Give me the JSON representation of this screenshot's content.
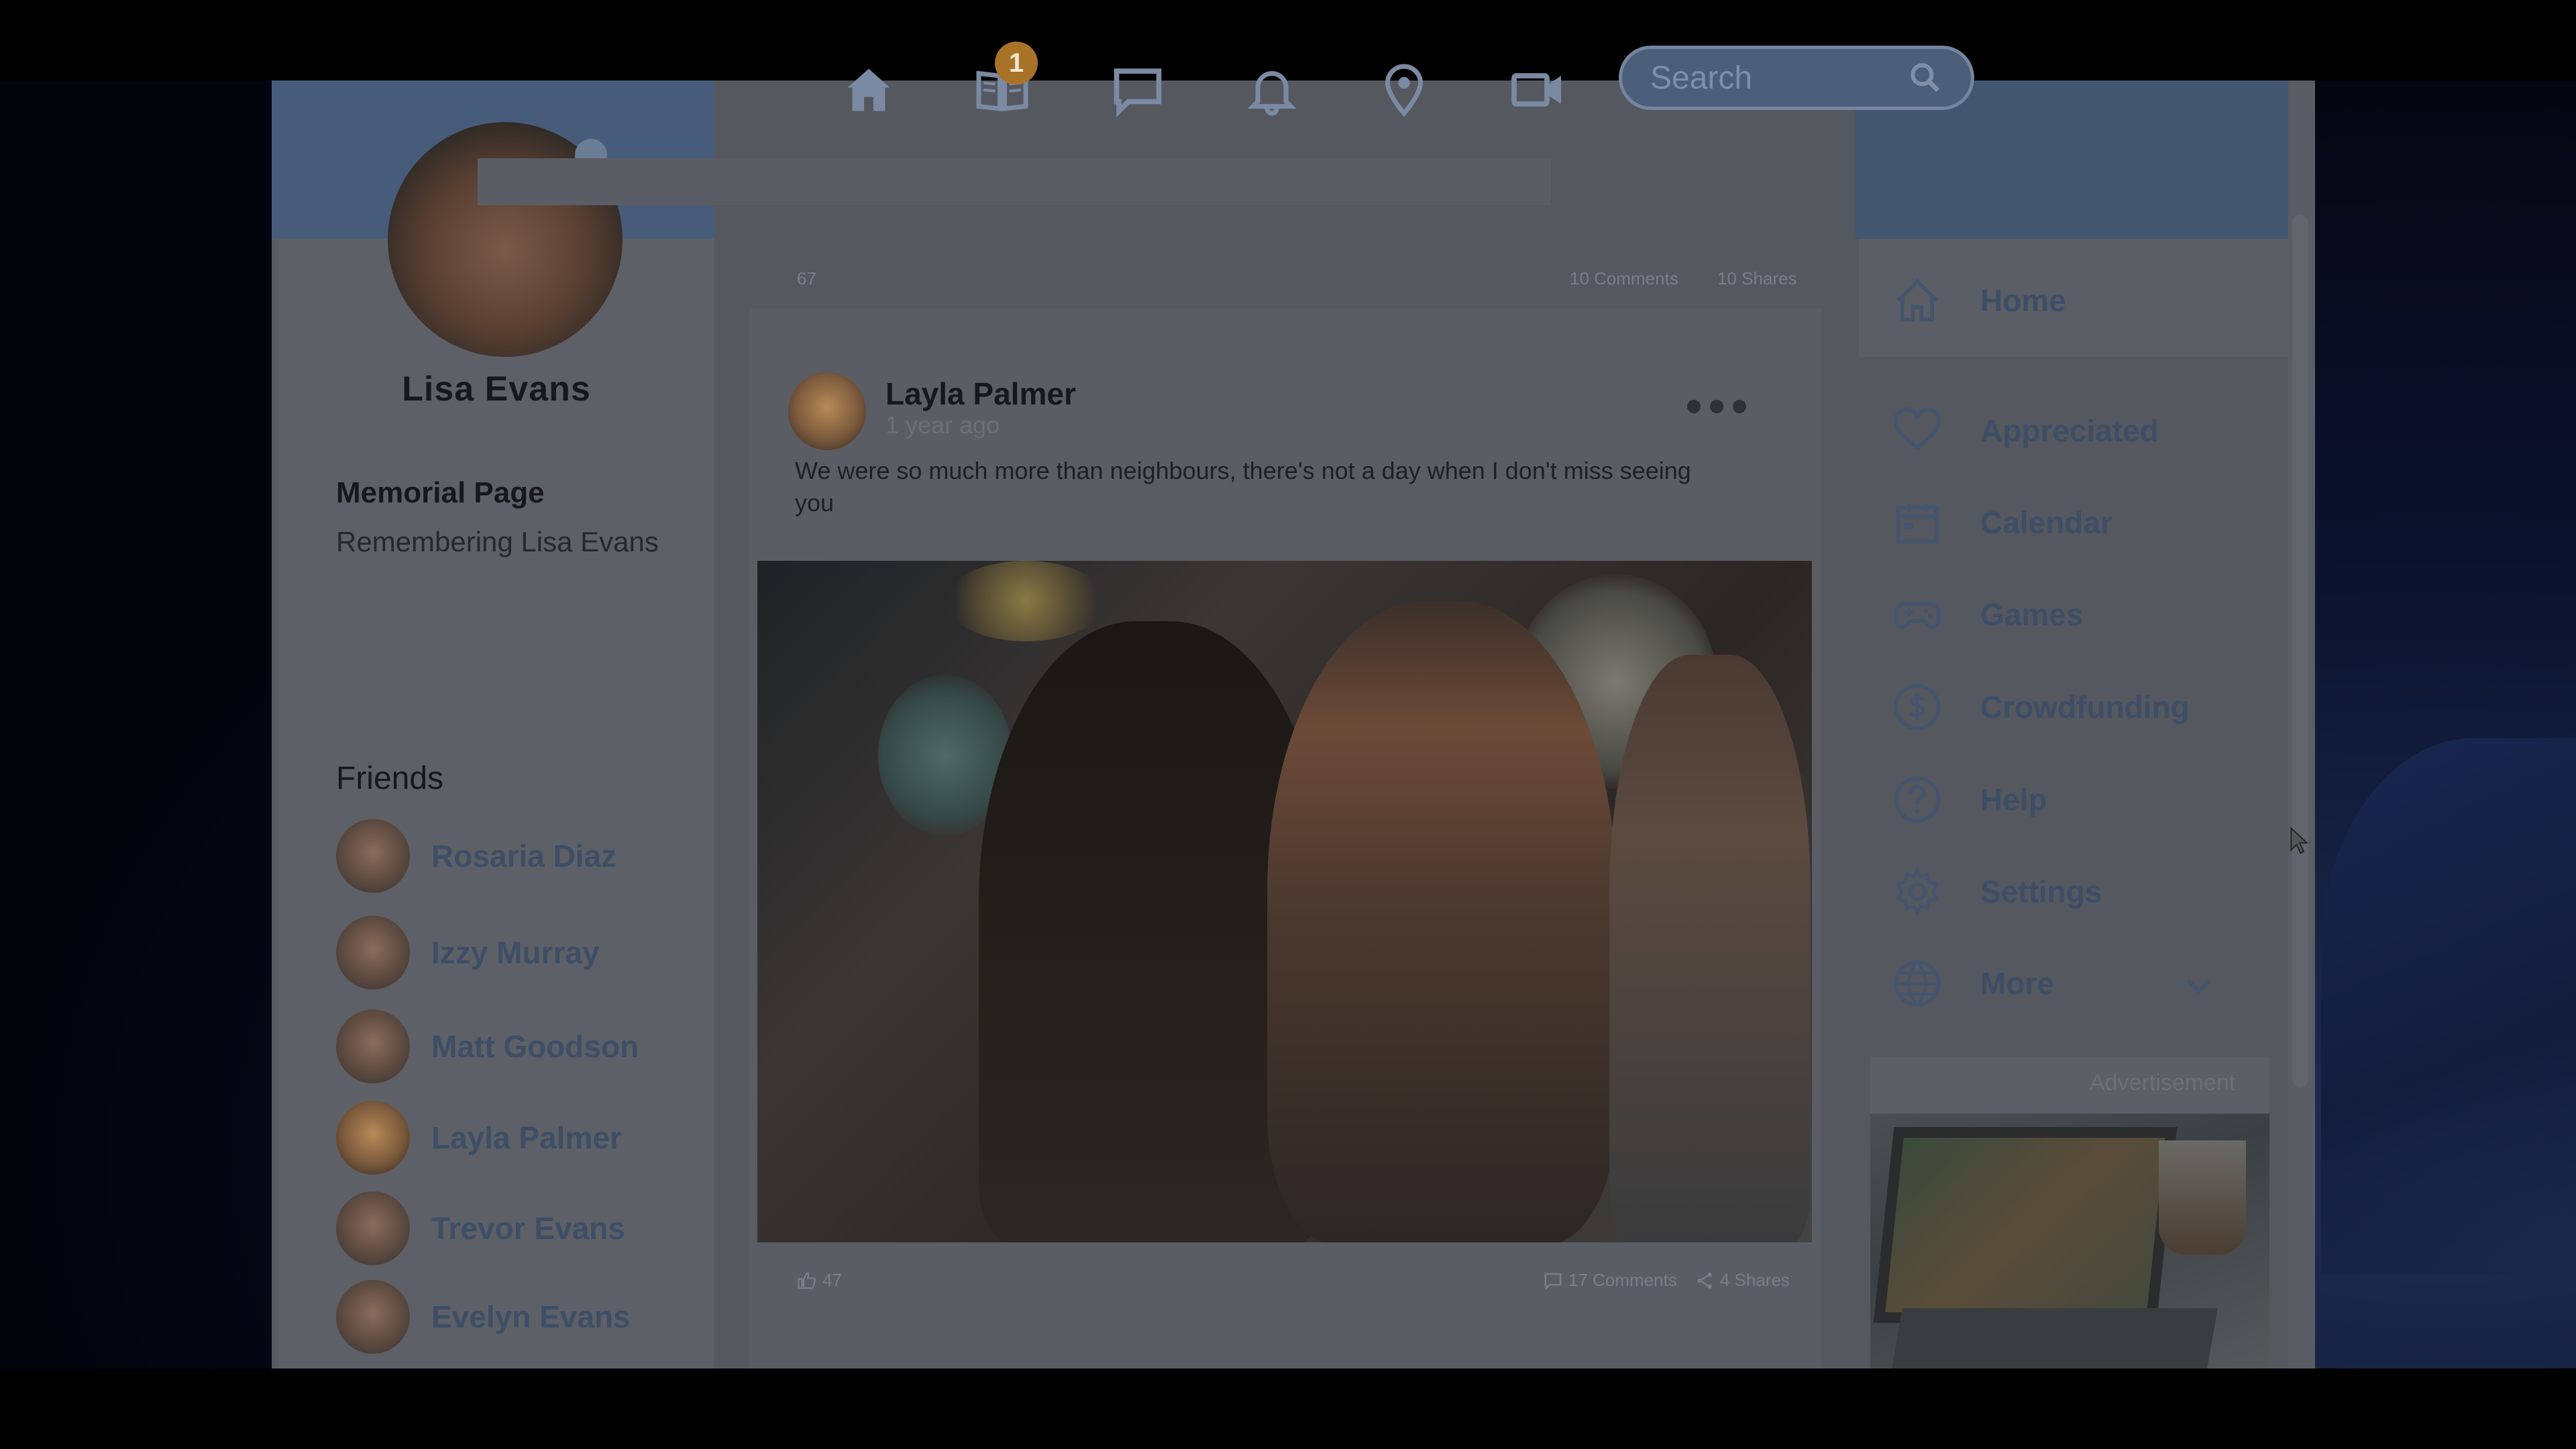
{
  "nav": {
    "icons": [
      "home-icon",
      "book-icon",
      "chat-icon",
      "notification-bell-icon",
      "location-pin-icon",
      "video-camera-icon",
      "group-icon"
    ],
    "notification_count": "1"
  },
  "search": {
    "placeholder": "Search"
  },
  "profile": {
    "name": "Lisa Evans",
    "page_type": "Memorial Page",
    "subtitle": "Remembering Lisa Evans"
  },
  "friends": {
    "title": "Friends",
    "items": [
      {
        "name": "Rosaria Diaz"
      },
      {
        "name": "Izzy Murray"
      },
      {
        "name": "Matt Goodson"
      },
      {
        "name": "Layla Palmer"
      },
      {
        "name": "Trevor Evans"
      },
      {
        "name": "Evelyn Evans"
      }
    ]
  },
  "prev_post": {
    "likes": "67",
    "comments": "10 Comments",
    "shares": "10 Shares"
  },
  "post": {
    "author": "Layla Palmer",
    "time": "1 year ago",
    "text": " We were so much more than neighbours, there's not a day when I don't miss seeing you",
    "likes": "47",
    "comments": "17 Comments",
    "shares": "4 Shares"
  },
  "menu": {
    "items": [
      {
        "label": "Home",
        "icon": "home-icon"
      },
      {
        "label": "Appreciated",
        "icon": "heart-icon"
      },
      {
        "label": "Calendar",
        "icon": "calendar-icon"
      },
      {
        "label": "Games",
        "icon": "gamepad-icon"
      },
      {
        "label": "Crowdfunding",
        "icon": "dollar-icon"
      },
      {
        "label": "Help",
        "icon": "help-icon"
      },
      {
        "label": "Settings",
        "icon": "gear-icon"
      },
      {
        "label": "More",
        "icon": "globe-icon"
      }
    ]
  },
  "ad": {
    "label": "Advertisement"
  },
  "colors": {
    "header": "#475c7a",
    "accent_text": "#3d4e66",
    "badge": "#a87326"
  }
}
